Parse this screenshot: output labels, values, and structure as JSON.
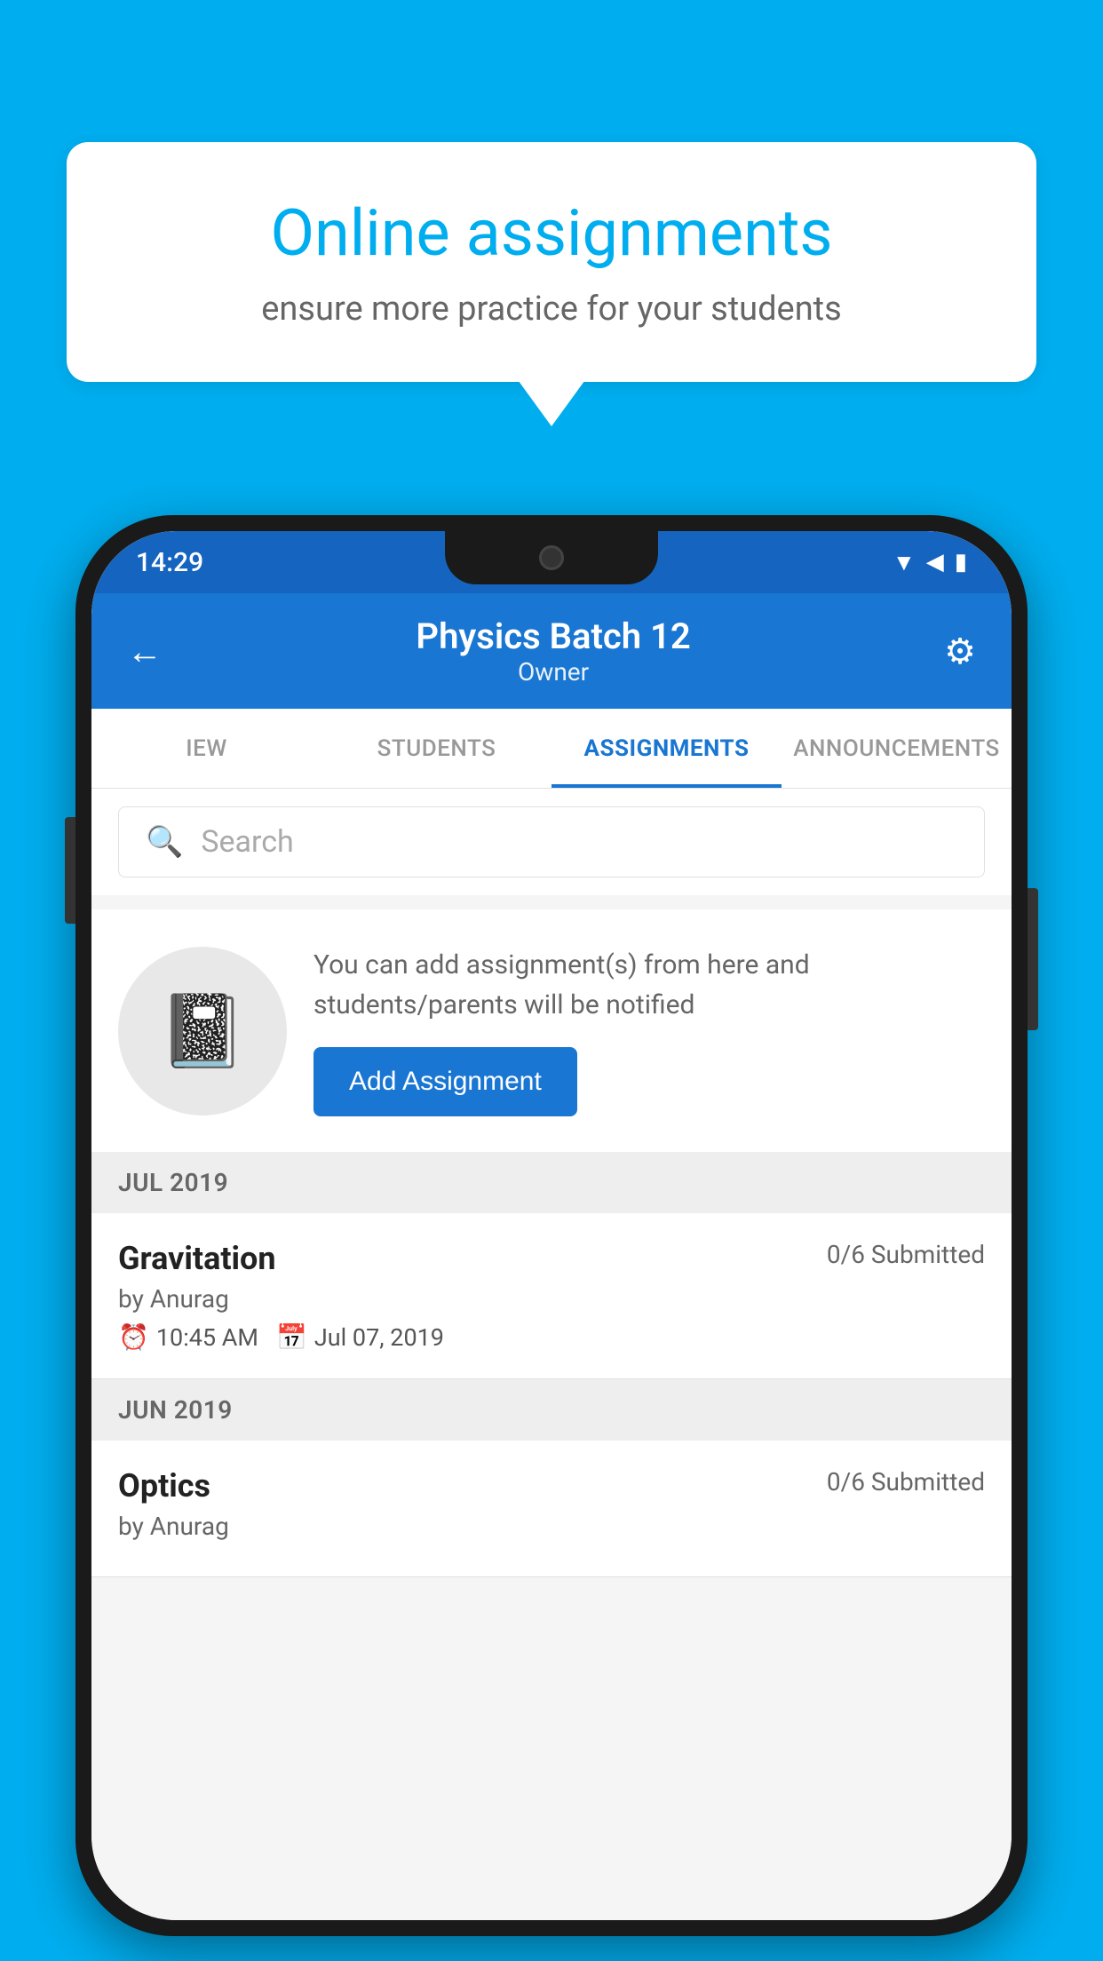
{
  "background_color": "#00AEEF",
  "speech_bubble": {
    "title": "Online assignments",
    "subtitle": "ensure more practice for your students"
  },
  "status_bar": {
    "time": "14:29",
    "icons": [
      "wifi",
      "signal",
      "battery"
    ]
  },
  "header": {
    "title": "Physics Batch 12",
    "subtitle": "Owner",
    "back_label": "←",
    "settings_label": "⚙"
  },
  "tabs": [
    {
      "label": "IEW",
      "active": false
    },
    {
      "label": "STUDENTS",
      "active": false
    },
    {
      "label": "ASSIGNMENTS",
      "active": true
    },
    {
      "label": "ANNOUNCEMENTS",
      "active": false
    }
  ],
  "search": {
    "placeholder": "Search"
  },
  "assignment_promo": {
    "description": "You can add assignment(s) from here and students/parents will be notified",
    "button_label": "Add Assignment"
  },
  "sections": [
    {
      "month_label": "JUL 2019",
      "assignments": [
        {
          "name": "Gravitation",
          "submitted": "0/6 Submitted",
          "author": "by Anurag",
          "time": "10:45 AM",
          "date": "Jul 07, 2019"
        }
      ]
    },
    {
      "month_label": "JUN 2019",
      "assignments": [
        {
          "name": "Optics",
          "submitted": "0/6 Submitted",
          "author": "by Anurag",
          "time": "",
          "date": ""
        }
      ]
    }
  ]
}
